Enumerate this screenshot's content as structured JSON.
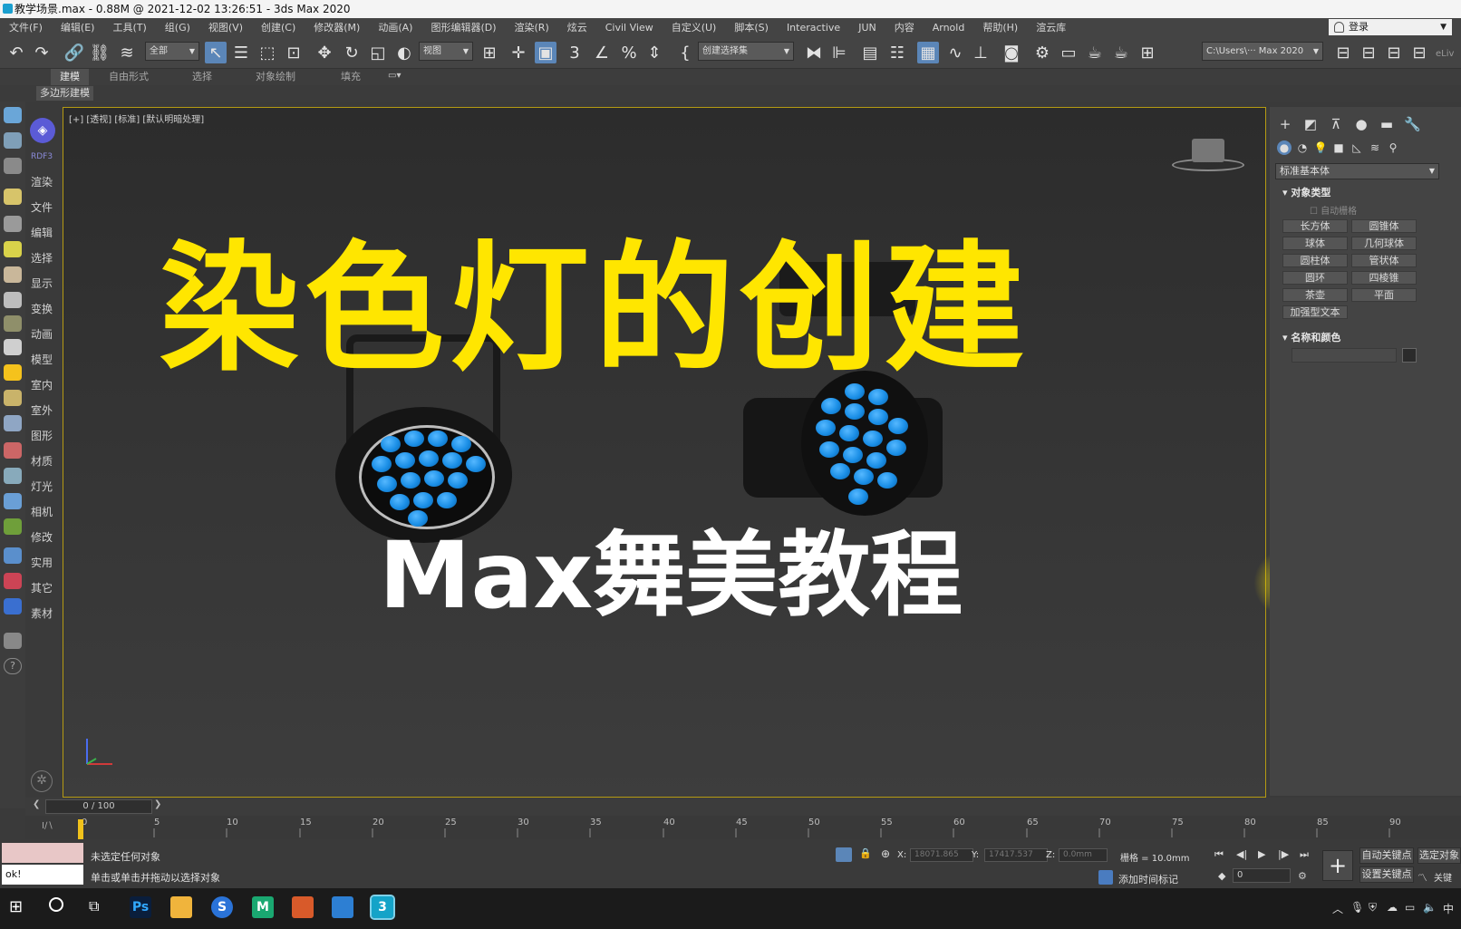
{
  "window": {
    "title": "教学场景.max - 0.88M @ 2021-12-02 13:26:51 - 3ds Max 2020"
  },
  "menu": [
    "文件(F)",
    "编辑(E)",
    "工具(T)",
    "组(G)",
    "视图(V)",
    "创建(C)",
    "修改器(M)",
    "动画(A)",
    "图形编辑器(D)",
    "渲染(R)",
    "炫云",
    "Civil View",
    "自定义(U)",
    "脚本(S)",
    "Interactive",
    "JUN",
    "内容",
    "Arnold",
    "帮助(H)",
    "渲云库"
  ],
  "account": {
    "login_label": "登录"
  },
  "toolbar": {
    "selection_filter": "全部",
    "ref_coord": "视图",
    "named_selection": "创建选择集",
    "path_field": "C:\\Users\\··· Max 2020",
    "live_label": "eLiv"
  },
  "ribbon": {
    "tabs": [
      "建模",
      "自由形式",
      "选择",
      "对象绘制",
      "填充"
    ],
    "active_tab": "建模",
    "sub_panel": "多边形建模"
  },
  "left_menu": {
    "badge_label": "RDF3",
    "items": [
      "渲染",
      "文件",
      "编辑",
      "选择",
      "显示",
      "变换",
      "动画",
      "模型",
      "室内",
      "室外",
      "图形",
      "材质",
      "灯光",
      "相机",
      "修改",
      "实用",
      "其它",
      "素材"
    ]
  },
  "viewport": {
    "label": "[+] [透视] [标准] [默认明暗处理]",
    "headline": "染色灯的创建",
    "subheadline": "Max舞美教程",
    "led_color": "#1a8ee6",
    "headline_color": "#ffe600"
  },
  "command_panel": {
    "category": "标准基本体",
    "object_type_title": "对象类型",
    "autogrid_label": "自动栅格",
    "primitives": [
      "长方体",
      "圆锥体",
      "球体",
      "几何球体",
      "圆柱体",
      "管状体",
      "圆环",
      "四棱锥",
      "茶壶",
      "平面",
      "加强型文本"
    ],
    "name_color_title": "名称和颜色"
  },
  "timeline": {
    "frame_display": "0 / 100",
    "ticks": [
      "0",
      "5",
      "10",
      "15",
      "20",
      "25",
      "30",
      "35",
      "40",
      "45",
      "50",
      "55",
      "60",
      "65",
      "70",
      "75",
      "80",
      "85",
      "90"
    ]
  },
  "status": {
    "maxscript_text": "ok!",
    "selection_status": "未选定任何对象",
    "prompt": "单击或单击并拖动以选择对象",
    "x_label": "X:",
    "x_value": "18071.865",
    "y_label": "Y:",
    "y_value": "17417.537",
    "z_label": "Z:",
    "z_value": "0.0mm",
    "grid": "栅格 = 10.0mm",
    "add_time_tag": "添加时间标记",
    "auto_key": "自动关键点",
    "set_key": "设置关键点",
    "selected_obj": "选定对象",
    "key_filters": "关键",
    "frame_field": "0"
  },
  "taskbar": {
    "apps": [
      "Ps",
      "文件",
      "S",
      "M",
      "办公",
      "照片",
      "3"
    ]
  }
}
